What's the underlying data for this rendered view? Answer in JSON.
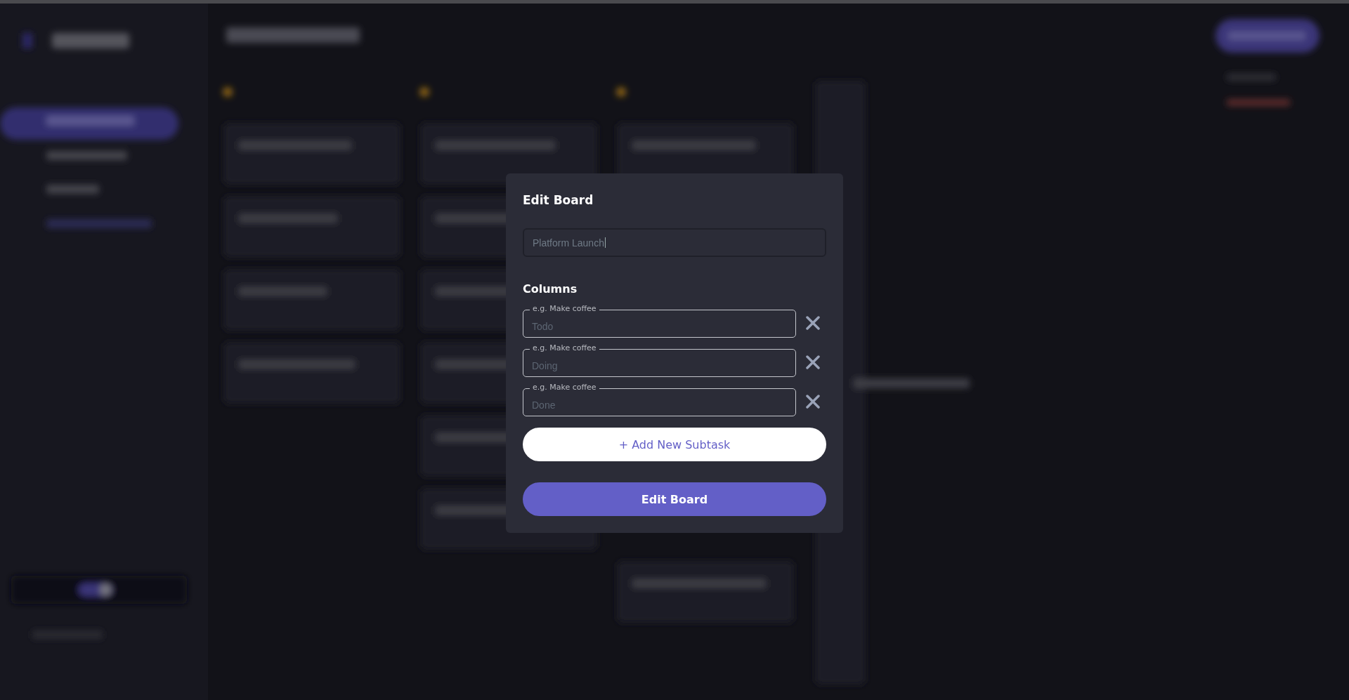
{
  "modal": {
    "title": "Edit Board",
    "board_name": {
      "value": "Platform Launch"
    },
    "columns_heading": "Columns",
    "columns": [
      {
        "label": "e.g. Make coffee",
        "value": "Todo"
      },
      {
        "label": "e.g. Make coffee",
        "value": "Doing"
      },
      {
        "label": "e.g. Make coffee",
        "value": "Done"
      }
    ],
    "add_button": "+ Add New Subtask",
    "submit_button": "Edit Board"
  }
}
